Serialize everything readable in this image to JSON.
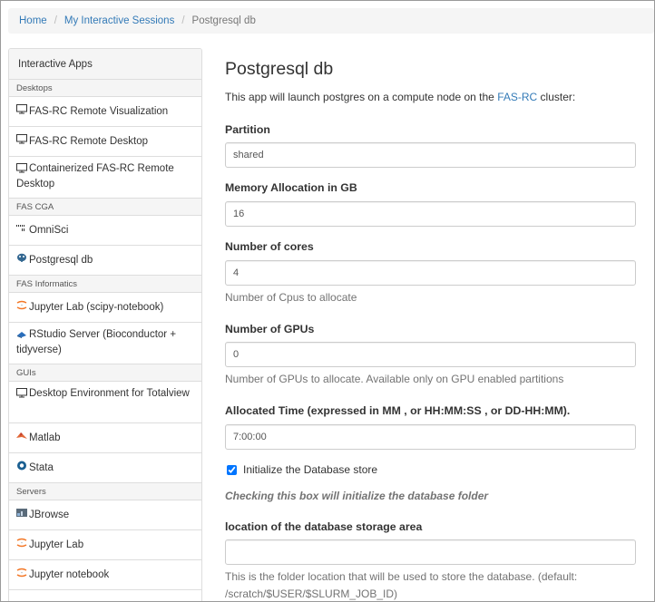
{
  "breadcrumb": {
    "home": "Home",
    "sessions": "My Interactive Sessions",
    "current": "Postgresql db"
  },
  "sidebar": {
    "heading": "Interactive Apps",
    "sections": [
      {
        "category": "Desktops",
        "items": [
          {
            "label": "FAS-RC Remote Visualization",
            "icon": "monitor-icon"
          },
          {
            "label": "FAS-RC Remote Desktop",
            "icon": "monitor-icon"
          },
          {
            "label": "Containerized FAS-RC Remote Desktop",
            "icon": "monitor-icon"
          }
        ]
      },
      {
        "category": "FAS CGA",
        "items": [
          {
            "label": "OmniSci",
            "icon": "omnisci-icon"
          },
          {
            "label": "Postgresql db",
            "icon": "postgres-elephant-icon"
          }
        ]
      },
      {
        "category": "FAS Informatics",
        "items": [
          {
            "label": "Jupyter Lab (scipy-notebook)",
            "icon": "jupyter-icon"
          },
          {
            "label": "RStudio Server (Bioconductor + tidyverse)",
            "icon": "rstudio-icon"
          }
        ]
      },
      {
        "category": "GUIs",
        "items": [
          {
            "label": "Desktop Environment for Totalview",
            "icon": "monitor-icon"
          },
          {
            "label": "Matlab",
            "icon": "matlab-icon"
          },
          {
            "label": "Stata",
            "icon": "stata-icon"
          }
        ]
      },
      {
        "category": "Servers",
        "items": [
          {
            "label": "JBrowse",
            "icon": "jbrowse-icon"
          },
          {
            "label": "Jupyter Lab",
            "icon": "jupyter-icon"
          },
          {
            "label": "Jupyter notebook",
            "icon": "jupyter-icon"
          }
        ]
      }
    ]
  },
  "main": {
    "title": "Postgresql db",
    "intro_text": "This app will launch postgres on a compute node on the ",
    "intro_link": "FAS-RC",
    "intro_suffix": " cluster:",
    "fields": {
      "partition": {
        "label": "Partition",
        "value": "shared"
      },
      "memory": {
        "label": "Memory Allocation in GB",
        "value": "16"
      },
      "cores": {
        "label": "Number of cores",
        "value": "4",
        "help": "Number of Cpus to allocate"
      },
      "gpus": {
        "label": "Number of GPUs",
        "value": "0",
        "help": "Number of GPUs to allocate. Available only on GPU enabled partitions"
      },
      "time": {
        "label": "Allocated Time (expressed in MM , or HH:MM:SS , or DD-HH:MM).",
        "value": "7:00:00"
      },
      "init_db": {
        "label": "Initialize the Database store",
        "checked": true,
        "help": "Checking this box will initialize the database folder"
      },
      "location": {
        "label": "location of the database storage area",
        "value": "",
        "help": "This is the folder location that will be used to store the database. (default: /scratch/$USER/$SLURM_JOB_ID)"
      }
    }
  },
  "colors": {
    "link": "#337ab7",
    "panel_bg": "#f5f5f5",
    "border": "#dddddd",
    "help_text": "#737373"
  }
}
